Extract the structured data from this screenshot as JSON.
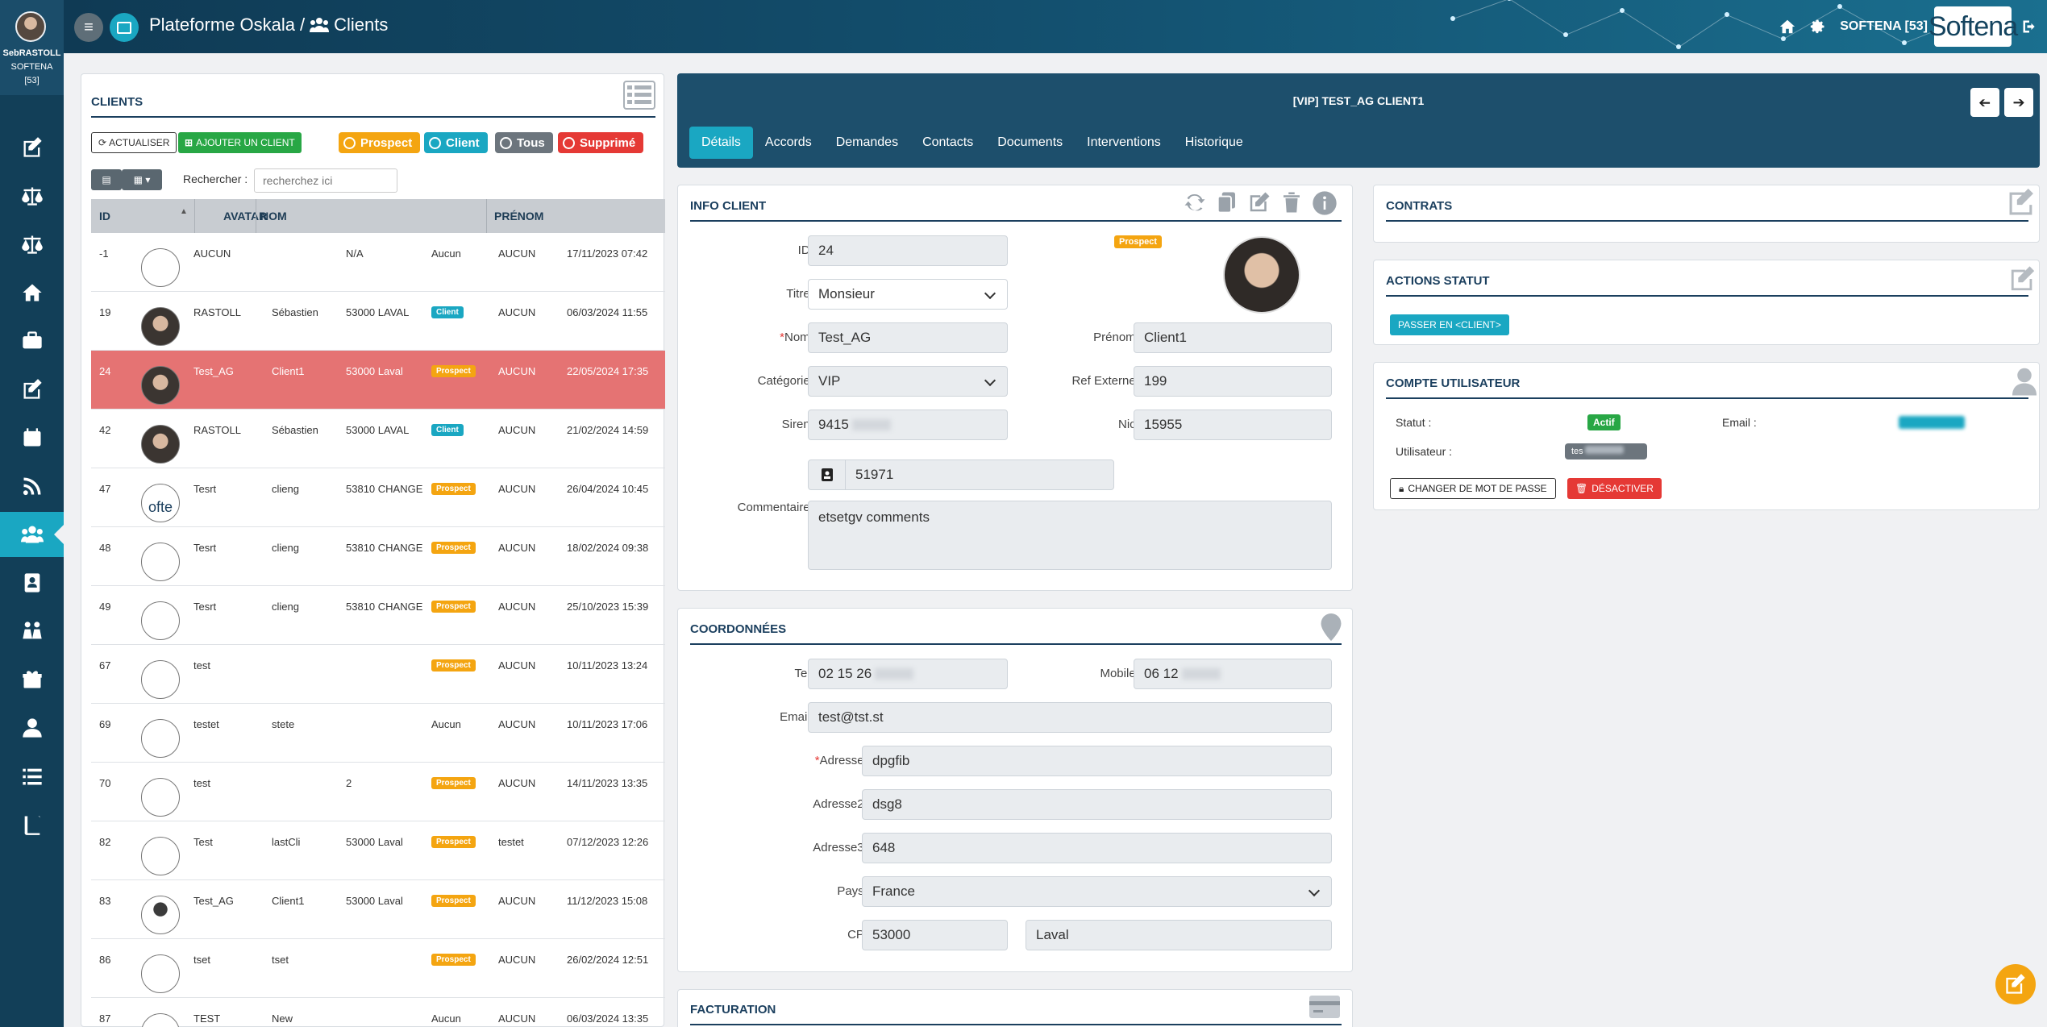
{
  "sidebar": {
    "user": {
      "name": "SebRASTOLL",
      "company": "SOFTENA",
      "count": "[53]"
    },
    "items": [
      {
        "icon": "edit-icon",
        "active": false
      },
      {
        "icon": "balance-scale-icon",
        "active": false
      },
      {
        "icon": "balance-scale-icon",
        "active": false
      },
      {
        "icon": "home-icon",
        "active": false
      },
      {
        "icon": "briefcase-icon",
        "active": false
      },
      {
        "icon": "edit-icon",
        "active": false
      },
      {
        "icon": "calendar-icon",
        "active": false
      },
      {
        "icon": "rss-icon",
        "active": false
      },
      {
        "icon": "users-icon",
        "active": true
      },
      {
        "icon": "address-book-icon",
        "active": false
      },
      {
        "icon": "people-icon",
        "active": false
      },
      {
        "icon": "gift-icon",
        "active": false
      },
      {
        "icon": "user-icon",
        "active": false
      },
      {
        "icon": "list-icon",
        "active": false
      },
      {
        "icon": "book-icon",
        "active": false
      }
    ]
  },
  "header": {
    "app": "Plateforme Oskala",
    "separator": "/",
    "section": "Clients",
    "user": "SOFTENA [53]",
    "logo": "Softena"
  },
  "clients": {
    "title": "CLIENTS",
    "refresh": "ACTUALISER",
    "add": "AJOUTER UN CLIENT",
    "filters": [
      {
        "label": "Prospect",
        "color": "#f4a511"
      },
      {
        "label": "Client",
        "color": "#1aa7c2"
      },
      {
        "label": "Tous",
        "color": "#6c757d"
      },
      {
        "label": "Supprimé",
        "color": "#e53935"
      }
    ],
    "search_label": "Rechercher :",
    "search_placeholder": "recherchez ici",
    "columns": [
      "ID",
      "AVATAR",
      "NOM",
      "PRÉNOM"
    ],
    "rows": [
      {
        "id": "-1",
        "avatar": "empty",
        "nom": "AUCUN",
        "prenom": "",
        "ville": "N/A",
        "badge": "",
        "ref": "Aucun",
        "date": "17/11/2023 07:42",
        "selected": false
      },
      {
        "id": "19",
        "avatar": "photo",
        "nom": "RASTOLL",
        "prenom": "Sébastien",
        "ville": "53000 LAVAL",
        "badge": "Client",
        "ref": "AUCUN",
        "date": "06/03/2024 11:55",
        "selected": false
      },
      {
        "id": "24",
        "avatar": "photo",
        "nom": "Test_AG",
        "prenom": "Client1",
        "ville": "53000 Laval",
        "badge": "Prospect",
        "ref": "AUCUN",
        "date": "22/05/2024 17:35",
        "selected": true
      },
      {
        "id": "42",
        "avatar": "photo",
        "nom": "RASTOLL",
        "prenom": "Sébastien",
        "ville": "53000 LAVAL",
        "badge": "Client",
        "ref": "AUCUN",
        "date": "21/02/2024 14:59",
        "selected": false
      },
      {
        "id": "47",
        "avatar": "softena",
        "nom": "Tesrt",
        "prenom": "clieng",
        "ville": "53810 CHANGE",
        "badge": "Prospect",
        "ref": "AUCUN",
        "date": "26/04/2024 10:45",
        "selected": false
      },
      {
        "id": "48",
        "avatar": "empty",
        "nom": "Tesrt",
        "prenom": "clieng",
        "ville": "53810 CHANGE",
        "badge": "Prospect",
        "ref": "AUCUN",
        "date": "18/02/2024 09:38",
        "selected": false
      },
      {
        "id": "49",
        "avatar": "empty",
        "nom": "Tesrt",
        "prenom": "clieng",
        "ville": "53810 CHANGE",
        "badge": "Prospect",
        "ref": "AUCUN",
        "date": "25/10/2023 15:39",
        "selected": false
      },
      {
        "id": "67",
        "avatar": "empty",
        "nom": "test",
        "prenom": "",
        "ville": "",
        "badge": "Prospect",
        "ref": "AUCUN",
        "date": "10/11/2023 13:24",
        "selected": false
      },
      {
        "id": "69",
        "avatar": "empty",
        "nom": "testet",
        "prenom": "stete",
        "ville": "",
        "badge": "",
        "ref": "Aucun",
        "date": "10/11/2023 17:06",
        "selected": false
      },
      {
        "id": "70",
        "avatar": "empty",
        "nom": "test",
        "prenom": "",
        "ville": "2",
        "badge": "Prospect",
        "ref": "AUCUN",
        "date": "14/11/2023 13:35",
        "selected": false
      },
      {
        "id": "82",
        "avatar": "empty",
        "nom": "Test",
        "prenom": "lastCli",
        "ville": "53000 Laval",
        "badge": "Prospect",
        "ref": "testet",
        "date": "07/12/2023 12:26",
        "selected": false
      },
      {
        "id": "83",
        "avatar": "dark",
        "nom": "Test_AG",
        "prenom": "Client1",
        "ville": "53000 Laval",
        "badge": "Prospect",
        "ref": "AUCUN",
        "date": "11/12/2023 15:08",
        "selected": false
      },
      {
        "id": "86",
        "avatar": "empty",
        "nom": "tset",
        "prenom": "tset",
        "ville": "",
        "badge": "Prospect",
        "ref": "AUCUN",
        "date": "26/02/2024 12:51",
        "selected": false
      },
      {
        "id": "87",
        "avatar": "empty",
        "nom": "TEST",
        "prenom": "New",
        "ville": "",
        "badge": "",
        "ref": "Aucun",
        "date": "06/03/2024 13:35",
        "selected": false
      }
    ]
  },
  "detail": {
    "title": "[VIP] TEST_AG CLIENT1",
    "tabs": [
      "Détails",
      "Accords",
      "Demandes",
      "Contacts",
      "Documents",
      "Interventions",
      "Historique"
    ],
    "active_tab": "Détails"
  },
  "info": {
    "title": "INFO CLIENT",
    "status_badge": "Prospect",
    "id_label": "ID :",
    "id": "24",
    "titre_label": "Titre :",
    "titre": "Monsieur",
    "nom_label": "Nom :",
    "nom": "Test_AG",
    "prenom_label": "Prénom :",
    "prenom": "Client1",
    "categorie_label": "Catégorie :",
    "categorie": "VIP",
    "ref_label": "Ref Externe :",
    "ref": "199",
    "siren_label": "Siren :",
    "siren": "9415",
    "nic_label": "Nic :",
    "nic": "15955",
    "code": "51971",
    "commentaire_label": "Commentaire :",
    "commentaire": "etsetgv comments"
  },
  "coord": {
    "title": "COORDONNÉES",
    "tel_label": "Tel :",
    "tel": "02 15 26",
    "mobile_label": "Mobile :",
    "mobile": "06 12",
    "email_label": "Email :",
    "email": "test@tst.st",
    "adresse_label": "Adresse :",
    "adresse": "dpgfib",
    "adresse2_label": "Adresse2 :",
    "adresse2": "dsg8",
    "adresse3_label": "Adresse3 :",
    "adresse3": "648",
    "pays_label": "Pays :",
    "pays": "France",
    "cp_label": "CP :",
    "cp": "53000",
    "ville": "Laval"
  },
  "facturation": {
    "title": "FACTURATION"
  },
  "contrats": {
    "title": "CONTRATS"
  },
  "actions": {
    "title": "ACTIONS STATUT",
    "button": "PASSER EN <CLIENT>"
  },
  "compte": {
    "title": "COMPTE UTILISATEUR",
    "statut_label": "Statut :",
    "statut": "Actif",
    "email_label": "Email :",
    "user_label": "Utilisateur :",
    "user": "tes",
    "change_pw": "CHANGER DE MOT DE PASSE",
    "deactivate": "DÉSACTIVER"
  }
}
